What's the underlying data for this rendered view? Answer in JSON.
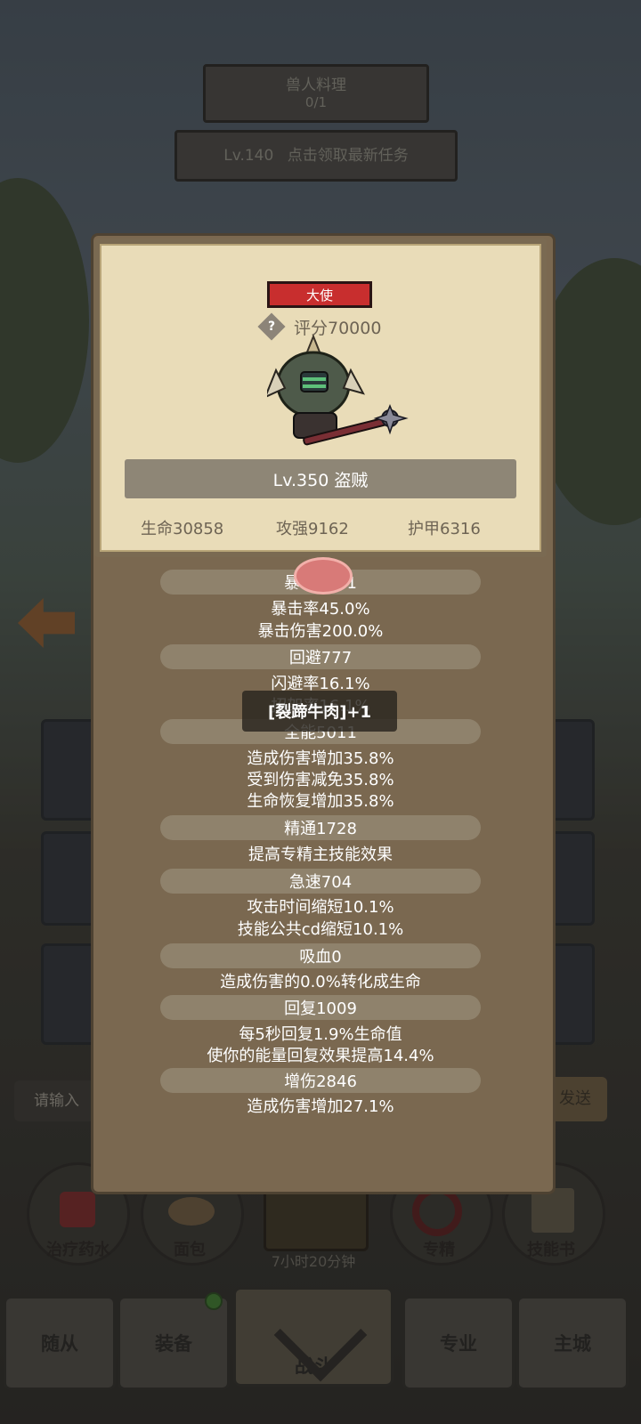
{
  "background": {
    "quest_title": "兽人料理",
    "quest_progress": "0/1",
    "task_banner": "点击领取最新任务",
    "task_level_hint": "Lv.140",
    "chat_placeholder": "请输入",
    "chat_send": "发送",
    "actions": [
      {
        "label": "治疗药水",
        "icon": "potion-icon"
      },
      {
        "label": "面包",
        "icon": "bread-icon"
      },
      {
        "label": "专精",
        "icon": "specialization-icon"
      },
      {
        "label": "技能书",
        "icon": "skillbook-icon"
      }
    ],
    "chest_timer": "7小时20分钟",
    "nav": {
      "followers": "随从",
      "equipment": "装备",
      "battle": "战斗",
      "profession": "专业",
      "main_city": "主城"
    }
  },
  "card": {
    "rank": "大使",
    "score_label": "评分70000",
    "name": "Lv.350 盗贼",
    "hp": "生命30858",
    "attack": "攻强9162",
    "armor": "护甲6316"
  },
  "stats": [
    {
      "title": "暴击4061",
      "lines": [
        "暴击率45.0%",
        "暴击伤害200.0%"
      ]
    },
    {
      "title": "回避777",
      "lines": [
        "闪避率16.1%",
        "招架率16.1%"
      ]
    },
    {
      "title": "全能5011",
      "lines": [
        "造成伤害增加35.8%",
        "受到伤害减免35.8%",
        "生命恢复增加35.8%"
      ]
    },
    {
      "title": "精通1728",
      "lines": [
        "提高专精主技能效果"
      ]
    },
    {
      "title": "急速704",
      "lines": [
        "攻击时间缩短10.1%",
        "技能公共cd缩短10.1%"
      ]
    },
    {
      "title": "吸血0",
      "lines": [
        "造成伤害的0.0%转化成生命"
      ]
    },
    {
      "title": "回复1009",
      "lines": [
        "每5秒回复1.9%生命值",
        "使你的能量回复效果提高14.4%"
      ]
    },
    {
      "title": "增伤2846",
      "lines": [
        "造成伤害增加27.1%"
      ]
    }
  ],
  "toast": "[裂蹄牛肉]+1"
}
